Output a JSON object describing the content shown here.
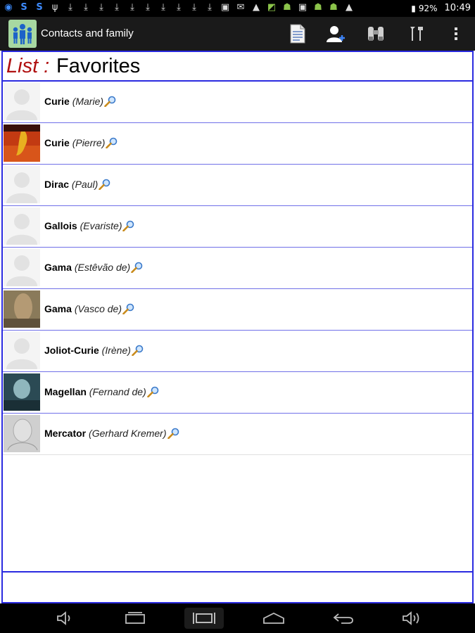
{
  "statusbar": {
    "battery": "92%",
    "time": "10:49",
    "icons": [
      "sync-icon",
      "skype-icon",
      "skype-icon",
      "usb-icon",
      "download-icon",
      "download-icon",
      "download-icon",
      "download-icon",
      "download-icon",
      "download-icon",
      "download-icon",
      "download-icon",
      "download-icon",
      "download-icon",
      "image-icon",
      "mail-icon",
      "warning-icon",
      "maps-icon",
      "android-icon",
      "image-icon",
      "android-icon",
      "android-icon",
      "warning-icon"
    ]
  },
  "actionbar": {
    "title": "Contacts and family",
    "buttons": [
      "document-icon",
      "contact-add-icon",
      "binoculars-icon",
      "tools-icon",
      "overflow-menu-icon"
    ]
  },
  "list": {
    "prefix": "List :",
    "title": "Favorites"
  },
  "contacts": [
    {
      "last": "Curie",
      "first": "(Marie)",
      "photo": "placeholder"
    },
    {
      "last": "Curie",
      "first": "(Pierre)",
      "photo": "red"
    },
    {
      "last": "Dirac",
      "first": "(Paul)",
      "photo": "placeholder"
    },
    {
      "last": "Gallois",
      "first": "(Evariste)",
      "photo": "placeholder"
    },
    {
      "last": "Gama",
      "first": "(Estêvão de)",
      "photo": "placeholder"
    },
    {
      "last": "Gama",
      "first": "(Vasco de)",
      "photo": "brown"
    },
    {
      "last": "Joliot-Curie",
      "first": "(Irène)",
      "photo": "placeholder"
    },
    {
      "last": "Magellan",
      "first": "(Fernand de)",
      "photo": "teal"
    },
    {
      "last": "Mercator",
      "first": "(Gerhard Kremer)",
      "photo": "sketch"
    }
  ],
  "navbar": {
    "buttons": [
      "volume-down-icon",
      "back-window-icon",
      "recent-apps-icon",
      "home-icon",
      "back-icon",
      "volume-up-icon"
    ]
  },
  "colors": {
    "accent_border": "#2a2ae0",
    "list_prefix": "#b01010",
    "app_icon_bg": "#a7d8a1"
  }
}
